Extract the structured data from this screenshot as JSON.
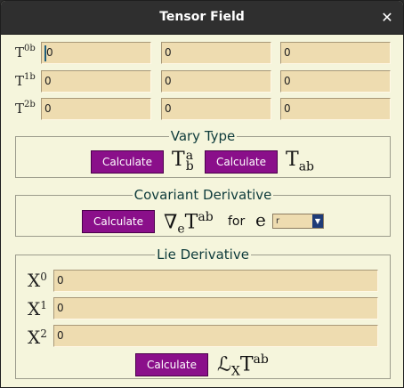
{
  "window": {
    "title": "Tensor Field"
  },
  "top": {
    "rows": [
      {
        "label_base": "T",
        "label_sup": "0b",
        "values": [
          "0",
          "0",
          "0"
        ]
      },
      {
        "label_base": "T",
        "label_sup": "1b",
        "values": [
          "0",
          "0",
          "0"
        ]
      },
      {
        "label_base": "T",
        "label_sup": "2b",
        "values": [
          "0",
          "0",
          "0"
        ]
      }
    ]
  },
  "vary_type": {
    "legend": "Vary Type",
    "button1_label": "Calculate",
    "button2_label": "Calculate",
    "expr1": {
      "base": "T",
      "sup": "a",
      "sub": "b"
    },
    "expr2": {
      "base": "T",
      "sub": "ab"
    }
  },
  "covariant": {
    "legend": "Covariant Derivative",
    "button_label": "Calculate",
    "expr": {
      "nabla": "∇",
      "nabla_sub": "e",
      "base": "T",
      "sup": "ab"
    },
    "for_label": "for",
    "var_label": "e",
    "select_value": "r"
  },
  "lie": {
    "legend": "Lie Derivative",
    "rows": [
      {
        "label_base": "X",
        "label_sup": "0",
        "value": "0"
      },
      {
        "label_base": "X",
        "label_sup": "1",
        "value": "0"
      },
      {
        "label_base": "X",
        "label_sup": "2",
        "value": "0"
      }
    ],
    "button_label": "Calculate",
    "expr": {
      "script_l": "ℒ",
      "sub": "X",
      "base": "T",
      "sup": "ab"
    }
  }
}
